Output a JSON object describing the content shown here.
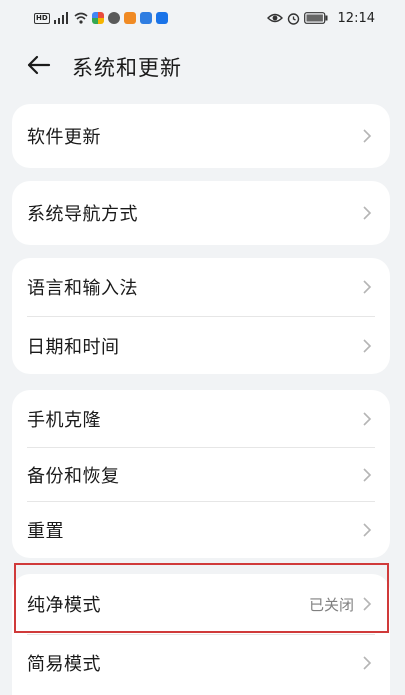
{
  "status_bar": {
    "left_icons": [
      "hd-icon",
      "signal-icon",
      "wifi-icon",
      "app-icon-1",
      "app-icon-2",
      "app-icon-3",
      "app-icon-4",
      "app-icon-5"
    ],
    "hd_label": "HD",
    "time": "12:14"
  },
  "header": {
    "title": "系统和更新"
  },
  "groups": [
    {
      "items": [
        {
          "label": "软件更新"
        }
      ]
    },
    {
      "items": [
        {
          "label": "系统导航方式"
        }
      ]
    },
    {
      "items": [
        {
          "label": "语言和输入法"
        },
        {
          "label": "日期和时间"
        }
      ]
    },
    {
      "items": [
        {
          "label": "手机克隆"
        },
        {
          "label": "备份和恢复"
        },
        {
          "label": "重置"
        }
      ]
    },
    {
      "items": [
        {
          "label": "纯净模式",
          "value": "已关闭"
        },
        {
          "label": "简易模式"
        }
      ]
    }
  ],
  "colors": {
    "highlight": "#d03a3a",
    "background": "#f1f3f5",
    "card": "#ffffff"
  }
}
